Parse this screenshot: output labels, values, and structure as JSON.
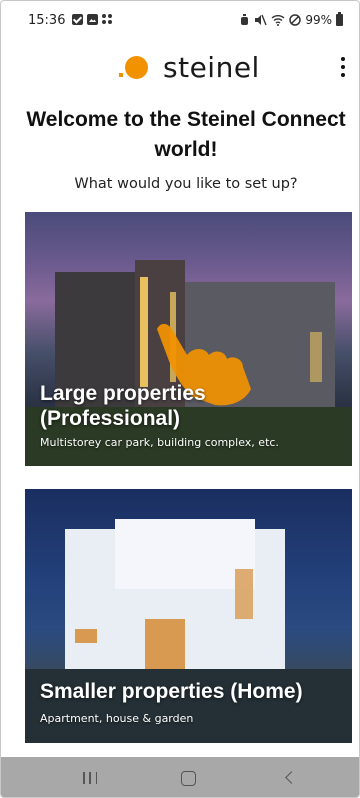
{
  "status_bar": {
    "time": "15:36",
    "battery_percent": "99%"
  },
  "header": {
    "logo_text": "steinel",
    "menu_icon": "more-vertical-icon"
  },
  "welcome_title": "Welcome to the Steinel Connect world!",
  "question": "What would you like to set up?",
  "options": [
    {
      "title": "Large properties (Professional)",
      "subtitle": "Multistorey car park, building complex, etc."
    },
    {
      "title": "Smaller properties (Home)",
      "subtitle": "Apartment, house & garden"
    }
  ],
  "colors": {
    "brand_orange": "#F39200",
    "nav_bar": "#A8A8A8"
  },
  "nav_bar": {
    "recent_icon": "recent-apps-icon",
    "home_icon": "home-icon",
    "back_icon": "back-icon"
  }
}
